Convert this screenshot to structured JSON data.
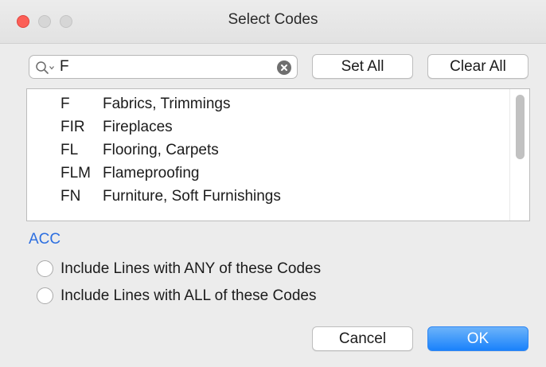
{
  "window": {
    "title": "Select Codes"
  },
  "search": {
    "value": "F"
  },
  "buttons": {
    "set_all": "Set All",
    "clear_all": "Clear All",
    "cancel": "Cancel",
    "ok": "OK"
  },
  "codes": [
    {
      "code": "F",
      "desc": "Fabrics, Trimmings"
    },
    {
      "code": "FIR",
      "desc": "Fireplaces"
    },
    {
      "code": "FL",
      "desc": "Flooring, Carpets"
    },
    {
      "code": "FLM",
      "desc": "Flameproofing"
    },
    {
      "code": "FN",
      "desc": "Furniture, Soft Furnishings"
    }
  ],
  "selected_codes": "ACC",
  "options": {
    "any": "Include Lines with ANY of these Codes",
    "all": "Include Lines with ALL of these Codes"
  },
  "colors": {
    "accent": "#1a82fb",
    "selected_text": "#2d6fe0",
    "close": "#fc5f57"
  }
}
